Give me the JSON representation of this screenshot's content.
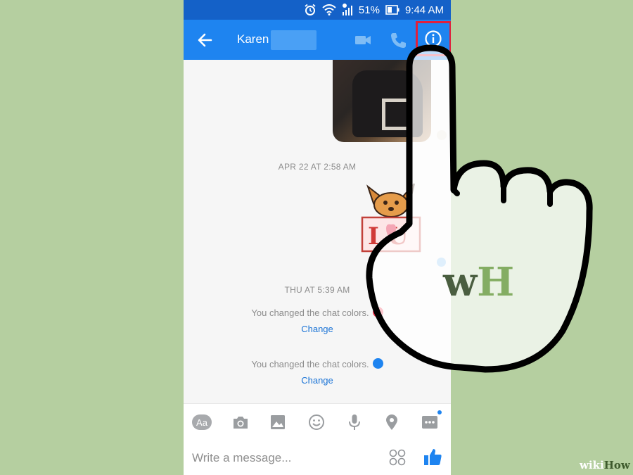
{
  "status_bar": {
    "battery": "51%",
    "time": "9:44 AM",
    "icons": [
      "alarm-icon",
      "wifi-icon",
      "signal-icon",
      "battery-icon"
    ]
  },
  "header": {
    "contact_name": "Karen",
    "icons": [
      "back-arrow-icon",
      "video-call-icon",
      "phone-call-icon",
      "info-icon"
    ]
  },
  "conversation": {
    "timestamps": [
      "APR 22 AT 2:58 AM",
      "THU AT 5:39 AM"
    ],
    "system_messages": [
      {
        "text": "You changed the chat colors.",
        "color": "#f0364f",
        "action": "Change"
      },
      {
        "text": "You changed the chat colors.",
        "color": "#1e84f0",
        "action": "Change"
      }
    ],
    "sticker_text": "I U"
  },
  "toolbar": {
    "text_button": "Aa",
    "icons": [
      "camera-icon",
      "gallery-icon",
      "emoji-icon",
      "microphone-icon",
      "location-icon",
      "more-icon"
    ]
  },
  "composer": {
    "placeholder": "Write a message..."
  },
  "watermark": {
    "logo": "wH",
    "site_prefix": "wiki",
    "site_suffix": "How"
  },
  "colors": {
    "status_bar": "#1461c8",
    "app_bar": "#1e84f0",
    "highlight": "#e0203c",
    "background": "#b5cfa0",
    "link": "#1a73d6"
  }
}
